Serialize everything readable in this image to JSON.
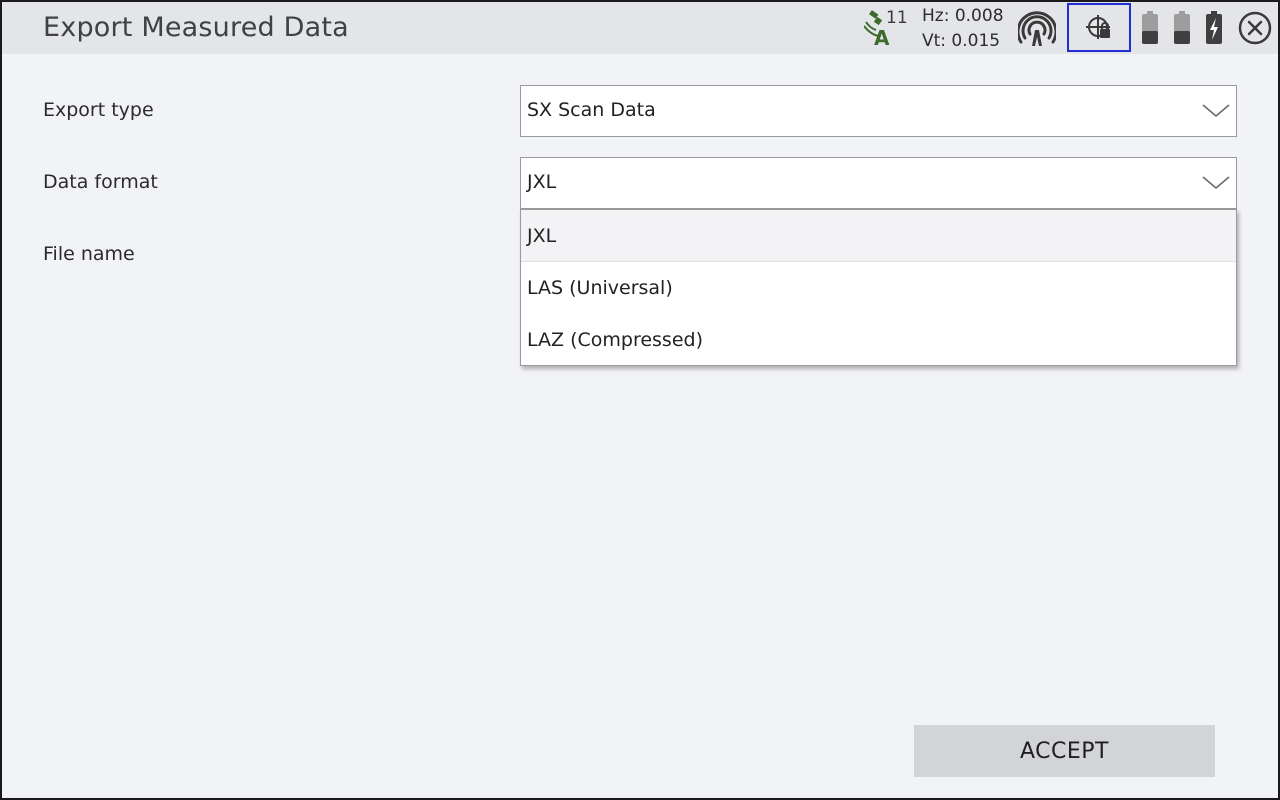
{
  "window": {
    "title": "Export Measured Data"
  },
  "status": {
    "satellite_count": "11",
    "hz": "Hz: 0.008",
    "vt": "Vt: 0.015",
    "icons": [
      "satellite-icon",
      "radio-signal-icon",
      "target-lock-icon",
      "battery-icon",
      "battery-icon",
      "battery-charging-icon",
      "close-icon"
    ],
    "accent_color": "#1f2fd4",
    "satellite_color": "#3d6b2e"
  },
  "form": {
    "export_type": {
      "label": "Export type",
      "value": "SX Scan Data"
    },
    "data_format": {
      "label": "Data format",
      "value": "JXL"
    },
    "file_name": {
      "label": "File name"
    }
  },
  "dropdown": {
    "options": [
      "JXL",
      "LAS (Universal)",
      "LAZ (Compressed)"
    ],
    "selected": "JXL"
  },
  "footer": {
    "accept_label": "ACCEPT"
  }
}
